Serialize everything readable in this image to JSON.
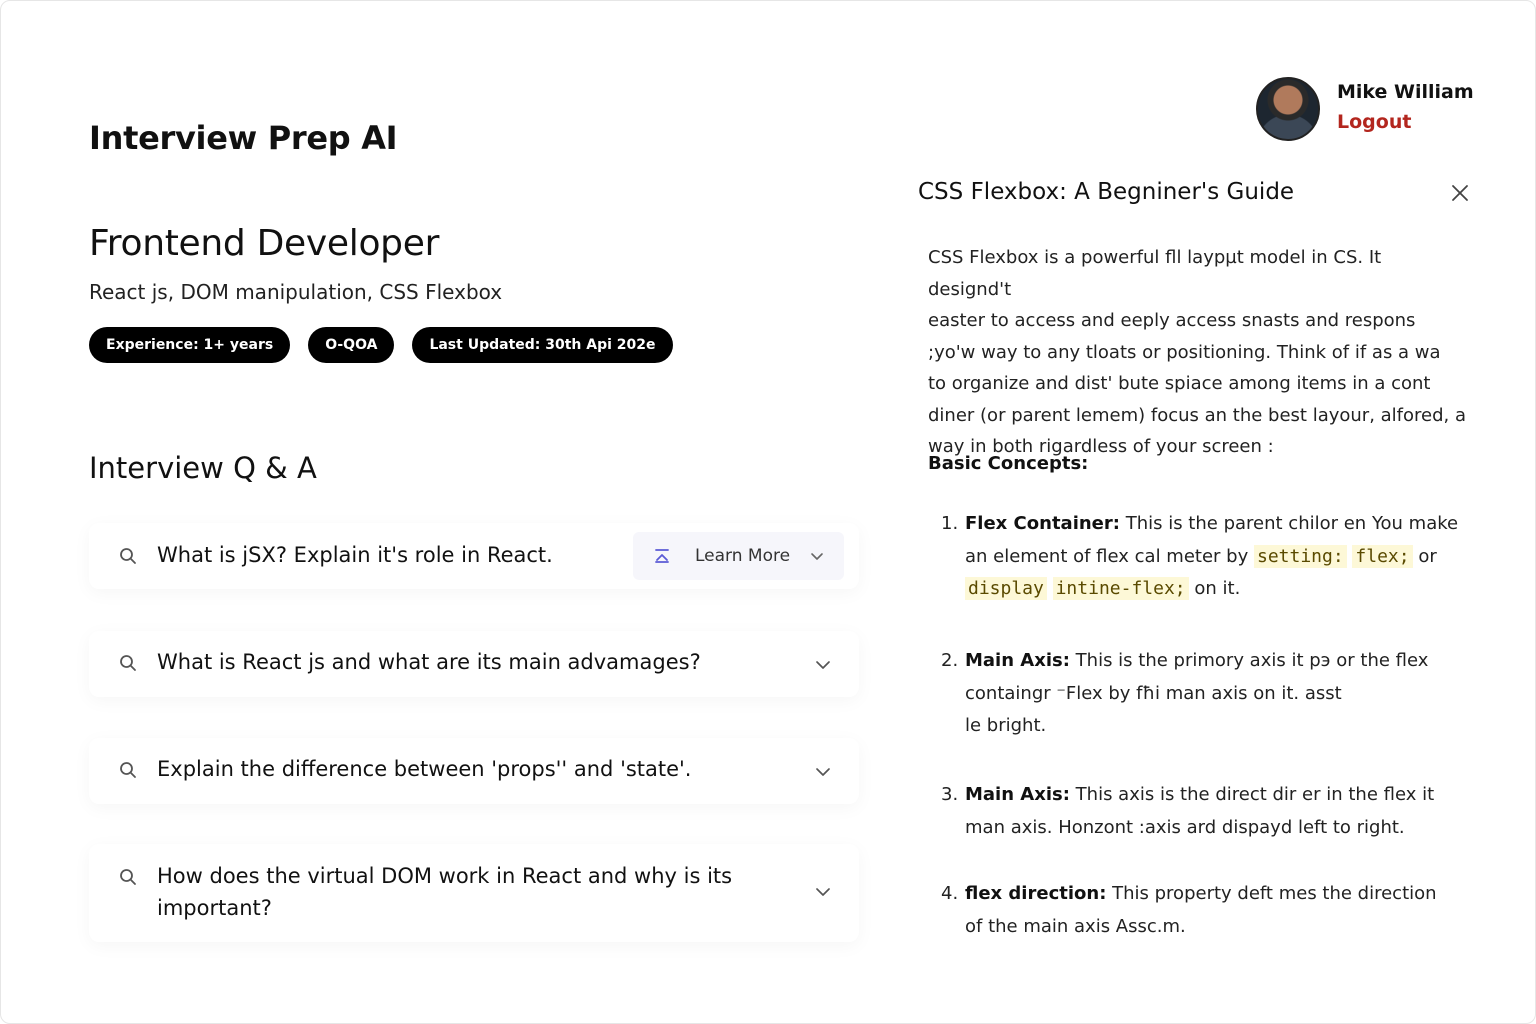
{
  "app": {
    "title": "Interview Prep AI"
  },
  "user": {
    "name": "Mike William",
    "logout_label": "Logout"
  },
  "session": {
    "role": "Frontend Developer",
    "topics": "React js, DOM manipulation, CSS Flexbox",
    "tags": [
      "Experience: 1+ years",
      "O-QOA",
      "Last Updated: 30th Api 202e"
    ]
  },
  "qa": {
    "heading": "Interview Q & A",
    "learn_more_label": "Learn More",
    "items": [
      {
        "question": "What is jSX? Explain it's role in React."
      },
      {
        "question": "What is React js and what are its main advamages?"
      },
      {
        "question": "Explain the difference between 'props'' and 'state'."
      },
      {
        "question_line1": "How does the virtual DOM work in React and why is its",
        "question_line2": "important?"
      }
    ]
  },
  "panel": {
    "title": "CSS Flexbox: A Begniner's Guide",
    "intro_lines": [
      "CSS Flexbox is a powerful fll laypµt model in CS. It designd't",
      "easter to access and eeply access snasts and respons",
      ";yo'w way to any tloats or positioning. Think of if as a wa",
      "to organize and dist' bute spiace among items in a cont",
      "diner (or parent lemem) focus an the best layour, alfored, a",
      "way in both rigardless of your screen :"
    ],
    "section_heading": "Basic Concepts:",
    "concepts": [
      {
        "number": "1.",
        "term": "Flex Container:",
        "line1": "This is the parent chilor en You make",
        "line2_text": "an element of flex cal meter by",
        "code1": "setting:",
        "code2": "flex;",
        "line2_tail": "or",
        "code3": "display",
        "code4": "intine-flex;",
        "line3_tail": "on it."
      },
      {
        "number": "2.",
        "term": "Main Axis:",
        "line1": "This is the primory axis it pэ or the flex",
        "line2": "containgr ⁻Flex by fħi man axis on it. asst",
        "line3": "le bright."
      },
      {
        "number": "3.",
        "term": "Main Axis:",
        "line1": "This axis is the direct dir er in the flex it",
        "line2": "man axis. Honzont :axis ard dispayd left to right."
      },
      {
        "number": "4.",
        "term": "flex direction:",
        "line1": "This property deft mes the direction",
        "line2": "of the main axis Assc.m."
      }
    ]
  },
  "icons": {
    "question": "search-icon",
    "expand": "chevron-down-icon",
    "learn_more": "collapse-icon",
    "close": "close-icon"
  },
  "colors": {
    "logout": "#b3261e",
    "tag_bg": "#000000",
    "code_bg": "#fdf8d7"
  }
}
